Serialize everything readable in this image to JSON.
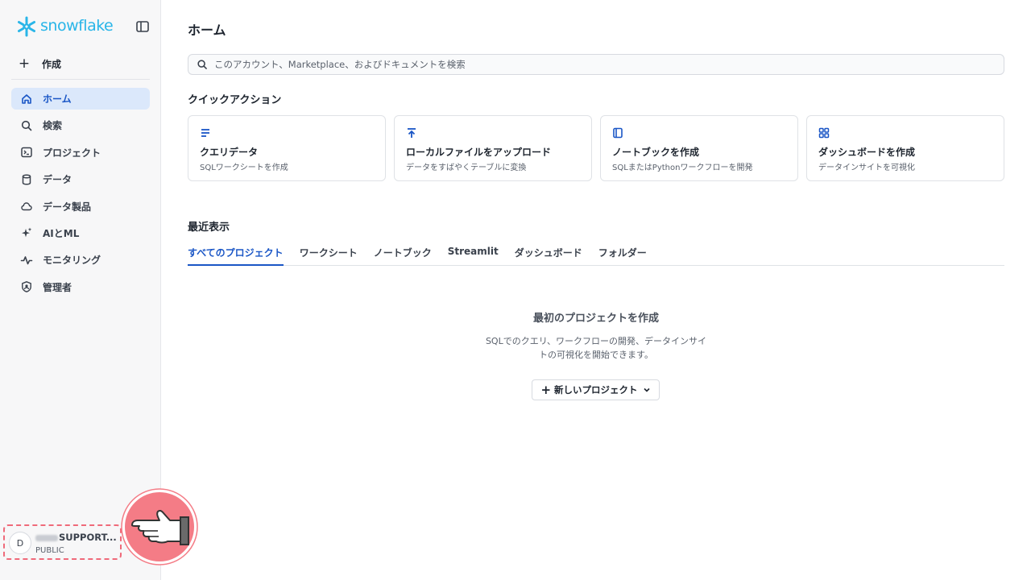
{
  "brand": {
    "name": "snowflake",
    "color": "#29b5e8"
  },
  "sidebar": {
    "create_label": "作成",
    "items": [
      {
        "label": "ホーム",
        "icon": "home-icon",
        "active": true
      },
      {
        "label": "検索",
        "icon": "search-icon"
      },
      {
        "label": "プロジェクト",
        "icon": "terminal-icon"
      },
      {
        "label": "データ",
        "icon": "database-icon"
      },
      {
        "label": "データ製品",
        "icon": "cloud-icon"
      },
      {
        "label": "AIとML",
        "icon": "sparkle-icon"
      },
      {
        "label": "モニタリング",
        "icon": "activity-icon"
      },
      {
        "label": "管理者",
        "icon": "shield-user-icon"
      }
    ],
    "account": {
      "initial": "D",
      "name": "SUPPORT...",
      "role": "PUBLIC"
    }
  },
  "main": {
    "title": "ホーム",
    "search": {
      "placeholder": "このアカウント、Marketplace、およびドキュメントを検索"
    },
    "quick_actions": {
      "title": "クイックアクション",
      "cards": [
        {
          "title": "クエリデータ",
          "desc": "SQLワークシートを作成",
          "icon": "lines-icon"
        },
        {
          "title": "ローカルファイルをアップロード",
          "desc": "データをすばやくテーブルに変換",
          "icon": "upload-icon"
        },
        {
          "title": "ノートブックを作成",
          "desc": "SQLまたはPythonワークフローを開発",
          "icon": "notebook-icon"
        },
        {
          "title": "ダッシュボードを作成",
          "desc": "データインサイトを可視化",
          "icon": "grid-icon"
        }
      ]
    },
    "recent": {
      "title": "最近表示",
      "tabs": [
        "すべてのプロジェクト",
        "ワークシート",
        "ノートブック",
        "Streamlit",
        "ダッシュボード",
        "フォルダー"
      ],
      "active_tab": 0,
      "empty": {
        "title": "最初のプロジェクトを作成",
        "desc": "SQLでのクエリ、ワークフローの開発、データインサイトの可視化を開始できます。",
        "button": "新しいプロジェクト"
      }
    }
  },
  "colors": {
    "accent": "#1a56c6",
    "active_bg": "#dbe8fb",
    "highlight": "#ef6a7a"
  }
}
